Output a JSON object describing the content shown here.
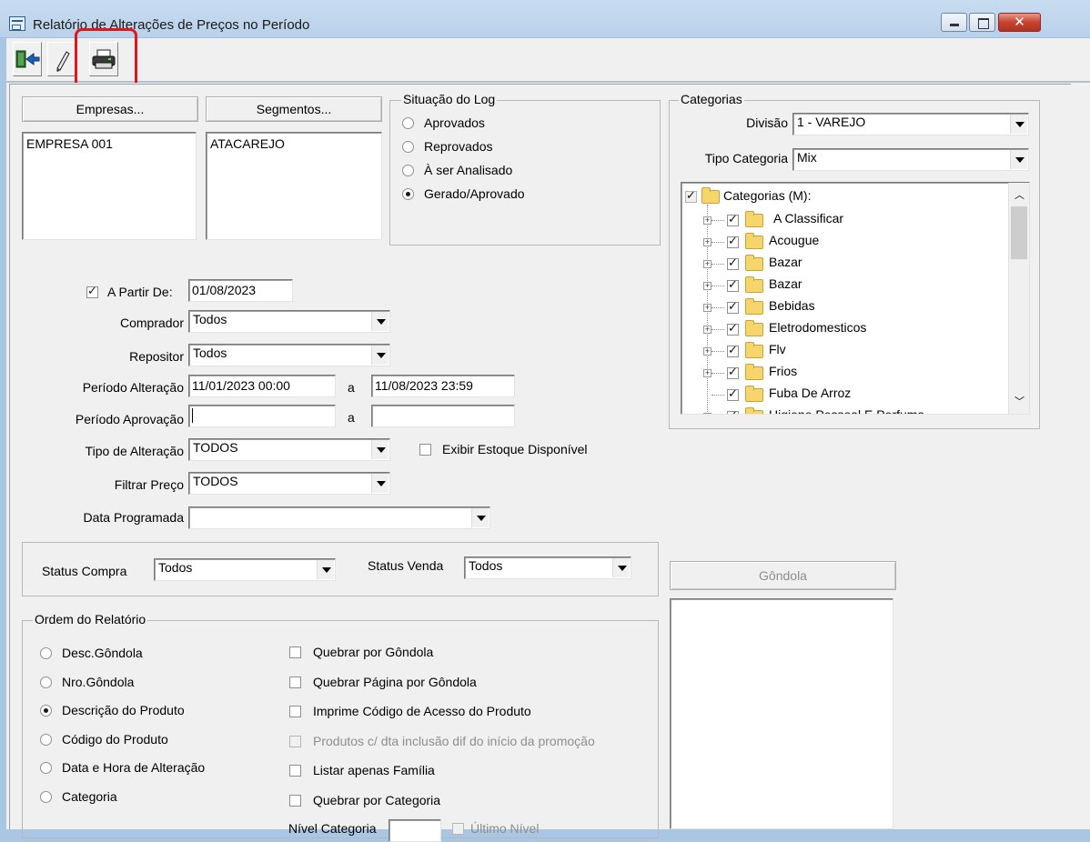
{
  "window": {
    "title": "Relatório de Alterações de Preços no Período",
    "close_glyph": "✕"
  },
  "toolbar": {
    "icons": [
      "exit-icon",
      "eraser-icon",
      "printer-icon"
    ]
  },
  "buttons": {
    "empresas": "Empresas...",
    "segmentos": "Segmentos...",
    "gondola": "Gôndola"
  },
  "lists": {
    "empresas": [
      "EMPRESA 001"
    ],
    "segmentos": [
      "ATACAREJO"
    ]
  },
  "situacao_log": {
    "title": "Situação do Log",
    "options": [
      "Aprovados",
      "Reprovados",
      "À ser Analisado",
      "Gerado/Aprovado"
    ],
    "selected": "Gerado/Aprovado"
  },
  "categorias": {
    "title": "Categorias",
    "divisao_label": "Divisão",
    "divisao_value": "1 - VAREJO",
    "tipo_label": "Tipo Categoria",
    "tipo_value": "Mix",
    "tree_root": "Categorias (M):",
    "tree_items": [
      "A Classificar",
      "Acougue",
      "Bazar",
      "Bazar",
      "Bebidas",
      "Eletrodomesticos",
      "Flv",
      "Frios",
      "Fuba De Arroz",
      "Higiene Pessoal E Perfuma"
    ]
  },
  "filters": {
    "a_partir_de_label": "A Partir De:",
    "a_partir_de_value": "01/08/2023",
    "comprador_label": "Comprador",
    "comprador_value": "Todos",
    "repositor_label": "Repositor",
    "repositor_value": "Todos",
    "periodo_alteracao_label": "Período Alteração",
    "periodo_alteracao_from": "11/01/2023  00:00",
    "periodo_alteracao_to": "11/08/2023  23:59",
    "periodo_aprovacao_label": "Período Aprovação",
    "periodo_aprovacao_from": "",
    "periodo_aprovacao_to": "",
    "separator_a": "a",
    "tipo_alteracao_label": "Tipo de Alteração",
    "tipo_alteracao_value": "TODOS",
    "exibir_estoque_label": "Exibir Estoque Disponível",
    "filtrar_preco_label": "Filtrar Preço",
    "filtrar_preco_value": "TODOS",
    "data_programada_label": "Data Programada",
    "data_programada_value": ""
  },
  "status": {
    "compra_label": "Status Compra",
    "compra_value": "Todos",
    "venda_label": "Status Venda",
    "venda_value": "Todos"
  },
  "ordem": {
    "title": "Ordem do Relatório",
    "options": [
      "Desc.Gôndola",
      "Nro.Gôndola",
      "Descrição do Produto",
      "Código do Produto",
      "Data e Hora de Alteração",
      "Categoria"
    ],
    "selected": "Descrição do Produto"
  },
  "checkboxes": [
    "Quebrar por Gôndola",
    "Quebrar Página por Gôndola",
    "Imprime Código de Acesso do Produto",
    "Produtos c/ dta inclusão dif do início da promoção",
    "Listar apenas Família",
    "Quebrar por Categoria"
  ],
  "nivel_categoria_label": "Nível Categoria",
  "ultimo_nivel_label": "Último Nível"
}
